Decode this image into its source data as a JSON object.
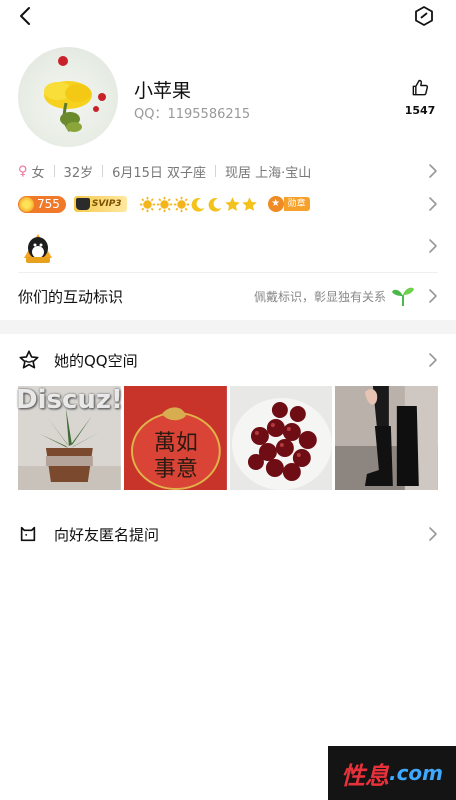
{
  "profile": {
    "nickname": "小苹果",
    "qq_label": "QQ：1195586215",
    "likes": "1547"
  },
  "info": {
    "gender": "女",
    "age": "32岁",
    "birthday": "6月15日 双子座",
    "location": "现居 上海·宝山"
  },
  "badges": {
    "level_value": "755",
    "svip": "SVIP3",
    "medal_label": "勋章"
  },
  "interact": {
    "title": "你们的互动标识",
    "hint": "佩戴标识，彰显独有关系"
  },
  "zone": {
    "title": "她的QQ空间",
    "watermark": "Discuz!"
  },
  "ask": {
    "title": "向好友匿名提问"
  },
  "brand": {
    "part1": "性息",
    "part2": ".com"
  },
  "icons": {
    "back": "back-arrow-icon",
    "more": "hexagon-icon",
    "like": "thumbs-up-icon",
    "gender": "female-icon",
    "zone": "star-outline-icon",
    "ask": "cat-box-icon",
    "sprout": "sprout-icon",
    "chevron": "chevron-right-icon"
  },
  "colors": {
    "accent_orange": "#f07a2a",
    "female_pink": "#e9739e",
    "sprout_green": "#4cb84c",
    "brand_red": "#e8313a",
    "brand_blue": "#3fa8ff"
  }
}
